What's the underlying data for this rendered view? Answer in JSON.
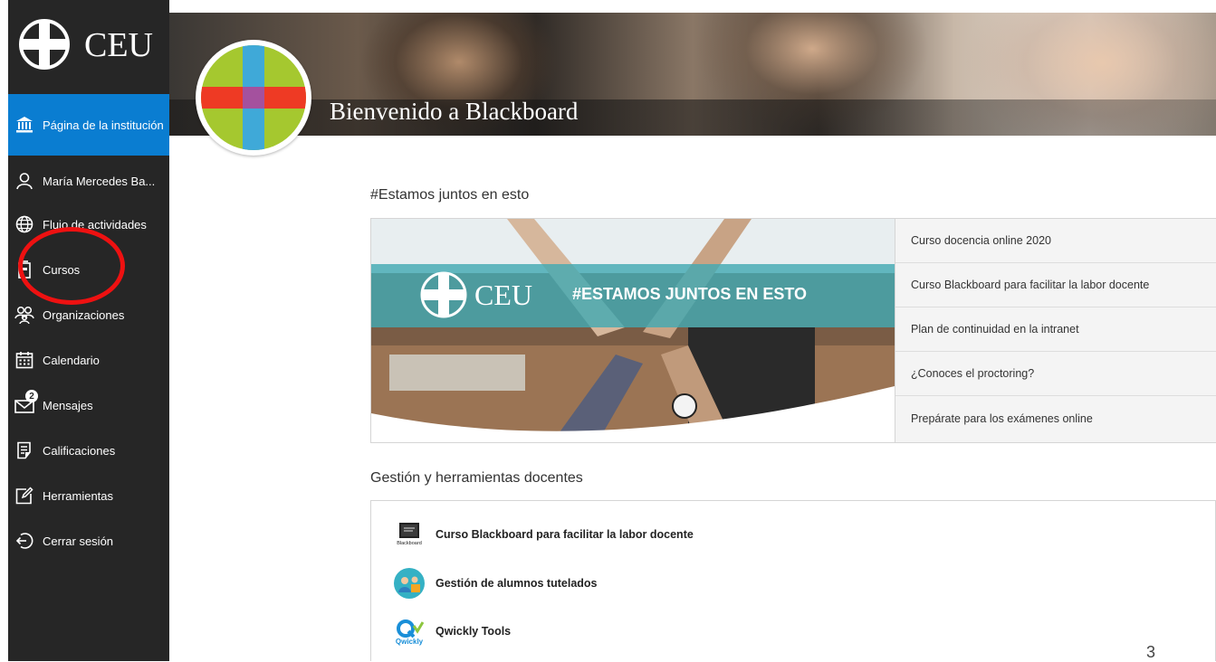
{
  "sidebar": {
    "logo_text": "CEU",
    "items": [
      {
        "label": "Página de la institución",
        "icon": "institution-icon"
      },
      {
        "label": "María Mercedes Ba...",
        "icon": "user-icon"
      },
      {
        "label": "Flujo de actividades",
        "icon": "globe-icon"
      },
      {
        "label": "Cursos",
        "icon": "courses-icon"
      },
      {
        "label": "Organizaciones",
        "icon": "organizations-icon"
      },
      {
        "label": "Calendario",
        "icon": "calendar-icon"
      },
      {
        "label": "Mensajes",
        "icon": "mail-icon",
        "badge": "2"
      },
      {
        "label": "Calificaciones",
        "icon": "grades-icon"
      },
      {
        "label": "Herramientas",
        "icon": "tools-icon"
      },
      {
        "label": "Cerrar sesión",
        "icon": "logout-icon"
      }
    ]
  },
  "banner": {
    "title": "Bienvenido a Blackboard"
  },
  "featured": {
    "title": "#Estamos juntos en esto",
    "image_logo_text": "CEU",
    "image_caption": "#ESTAMOS JUNTOS EN ESTO",
    "links": [
      "Curso docencia online 2020",
      "Curso Blackboard para facilitar la labor docente",
      "Plan de continuidad en la intranet",
      "¿Conoces el proctoring?",
      "Prepárate para los exámenes online"
    ]
  },
  "tools": {
    "title": "Gestión y herramientas docentes",
    "items": [
      {
        "label": "Curso Blackboard para facilitar la labor docente",
        "icon": "blackboard-icon",
        "icon_text": "Blackboard"
      },
      {
        "label": "Gestión de alumnos tutelados",
        "icon": "students-icon"
      },
      {
        "label": "Qwickly Tools",
        "icon": "qwickly-icon",
        "icon_text": "Qwickly"
      }
    ]
  },
  "page_number": "3",
  "colors": {
    "sidebar_bg": "#262626",
    "active_item": "#0a7dd1",
    "annotation_circle": "#e11111"
  }
}
